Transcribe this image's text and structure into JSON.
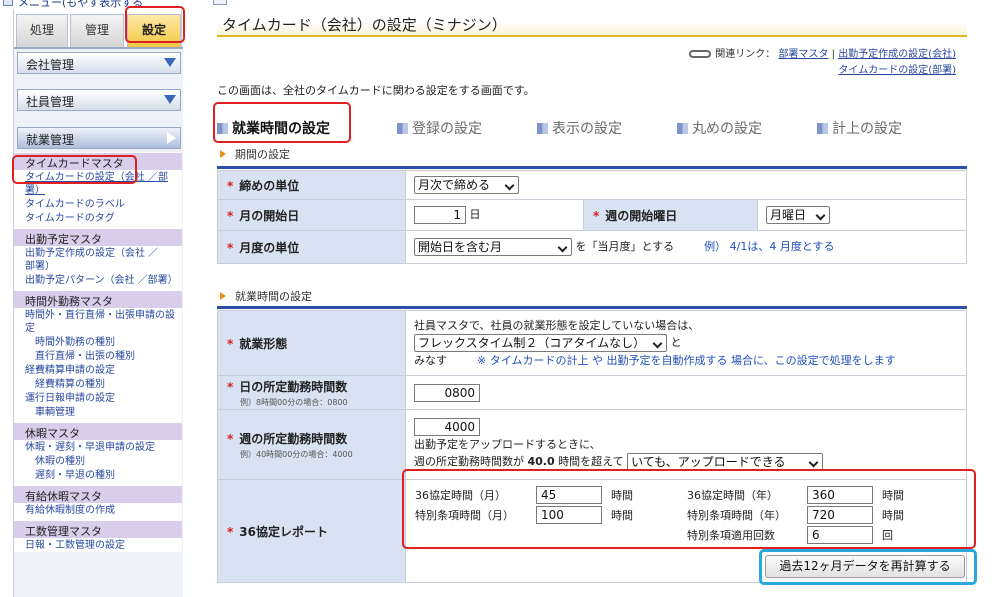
{
  "top": {
    "cut_text": "メニュー(もやす表示する"
  },
  "sidebar": {
    "tabs": [
      {
        "label": "処理"
      },
      {
        "label": "管理"
      },
      {
        "label": "設定"
      }
    ],
    "sections": [
      {
        "label": "会社管理"
      },
      {
        "label": "社員管理"
      },
      {
        "label": "就業管理"
      }
    ],
    "groups": [
      {
        "title": "タイムカードマスタ",
        "items": [
          {
            "label": "タイムカードの設定（会社 ／部署）",
            "sub": false
          },
          {
            "label": "タイムカードのラベル",
            "sub": false
          },
          {
            "label": "タイムカードのタグ",
            "sub": false
          }
        ]
      },
      {
        "title": "出勤予定マスタ",
        "items": [
          {
            "label": "出勤予定作成の設定（会社 ／部署）",
            "sub": false
          },
          {
            "label": "出勤予定パターン（会社 ／部署）",
            "sub": false
          }
        ]
      },
      {
        "title": "時間外勤務マスタ",
        "items": [
          {
            "label": "時間外・直行直帰・出張申請の設定",
            "sub": false
          },
          {
            "label": "時間外勤務の種別",
            "sub": true
          },
          {
            "label": "直行直帰・出張の種別",
            "sub": true
          },
          {
            "label": "経費精算申請の設定",
            "sub": false
          },
          {
            "label": "経費精算の種別",
            "sub": true
          },
          {
            "label": "運行日報申請の設定",
            "sub": false
          },
          {
            "label": "車輌管理",
            "sub": true
          }
        ]
      },
      {
        "title": "休暇マスタ",
        "items": [
          {
            "label": "休暇・遅刻・早退申請の設定",
            "sub": false
          },
          {
            "label": "休暇の種別",
            "sub": true
          },
          {
            "label": "遅刻・早退の種別",
            "sub": true
          }
        ]
      },
      {
        "title": "有給休暇マスタ",
        "items": [
          {
            "label": "有給休暇制度の作成",
            "sub": false
          }
        ]
      },
      {
        "title": "工数管理マスタ",
        "items": [
          {
            "label": "日報・工数管理の設定",
            "sub": false
          }
        ]
      }
    ]
  },
  "page": {
    "title": "タイムカード（会社）の設定（ミナジン）",
    "related_label": "関連リンク：",
    "related_links": [
      "部署マスタ",
      "出勤予定作成の設定(会社)",
      "タイムカードの設定(部署)"
    ],
    "separator": "|",
    "intro": "この画面は、全社のタイムカードに関わる設定をする画面です。"
  },
  "settings_tabs": [
    {
      "label": "就業時間の設定"
    },
    {
      "label": "登録の設定"
    },
    {
      "label": "表示の設定"
    },
    {
      "label": "丸めの設定"
    },
    {
      "label": "計上の設定"
    }
  ],
  "period": {
    "title": "期間の設定",
    "closing_unit": {
      "label": "締めの単位",
      "value": "月次で締める"
    },
    "month_start": {
      "label": "月の開始日",
      "value": "1",
      "suffix": "日"
    },
    "week_start": {
      "label": "週の開始曜日",
      "value": "月曜日"
    },
    "month_unit": {
      "label": "月度の単位",
      "value": "開始日を含む月",
      "suffix": "を「当月度」とする",
      "example": "例） 4/1は、4 月度とする"
    }
  },
  "worktime": {
    "title": "就業時間の設定",
    "form": {
      "label": "就業形態",
      "line1": "社員マスタで、社員の就業形態を設定していない場合は、",
      "value": "フレックスタイム制２（コアタイムなし）",
      "after": "と",
      "line3a": "みなす",
      "line3b": "※ タイムカードの計上 や 出勤予定を自動作成する 場合に、この設定で処理をします"
    },
    "daily": {
      "label": "日の所定勤務時間数",
      "note": "例）8時間00分の場合：0800",
      "value": "0800"
    },
    "weekly": {
      "label": "週の所定勤務時間数",
      "note": "例）40時間00分の場合：4000",
      "value": "4000",
      "line1": "出勤予定をアップロードするときに、",
      "line2a": "週の所定勤務時間数が",
      "line2b": "40.0",
      "line2c": "時間を超えて",
      "select": "いても、アップロードできる"
    },
    "report": {
      "label": "36協定レポート",
      "month_label": "36協定時間（月）",
      "month_value": "45",
      "month_unit": "時間",
      "year_label": "36協定時間（年）",
      "year_value": "360",
      "year_unit": "時間",
      "sp_month_label": "特別条項時間（月）",
      "sp_month_value": "100",
      "sp_month_unit": "時間",
      "sp_year_label": "特別条項時間（年）",
      "sp_year_value": "720",
      "sp_year_unit": "時間",
      "sp_count_label": "特別条項適用回数",
      "sp_count_value": "6",
      "sp_count_unit": "回"
    },
    "recalc_button": "過去12ヶ月データを再計算する"
  },
  "colors": {
    "highlight_red": "#e02020",
    "highlight_blue": "#29a8e0",
    "accent_bar": "#2b4ea6",
    "label_bg": "#d8e2f3"
  }
}
